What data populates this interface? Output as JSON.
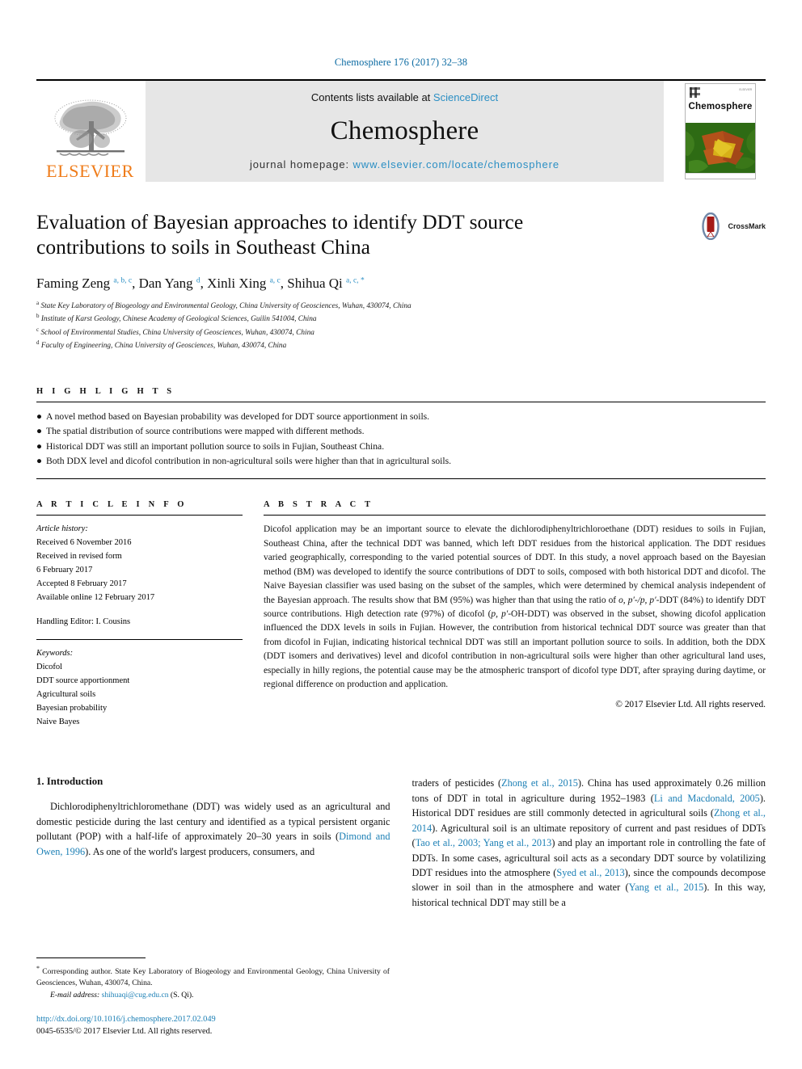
{
  "running_head": "Chemosphere 176 (2017) 32–38",
  "masthead": {
    "publisher_logo_text": "ELSEVIER",
    "contents_prefix": "Contents lists available at ",
    "contents_link": "ScienceDirect",
    "journal_name": "Chemosphere",
    "homepage_prefix": "journal homepage: ",
    "homepage_url": "www.elsevier.com/locate/chemosphere",
    "cover_title": "Chemosphere",
    "cover_tiny_text": "ELSEVIER"
  },
  "article": {
    "title": "Evaluation of Bayesian approaches to identify DDT source contributions to soils in Southeast China",
    "crossmark_label": "CrossMark",
    "authors_html": "Faming Zeng <sup>a, b, c</sup>, Dan Yang <sup>d</sup>, Xinli Xing <sup>a, c</sup>, Shihua Qi <sup>a, c, *</sup>",
    "affiliations": [
      {
        "marker": "a",
        "text": "State Key Laboratory of Biogeology and Environmental Geology, China University of Geosciences, Wuhan, 430074, China"
      },
      {
        "marker": "b",
        "text": "Institute of Karst Geology, Chinese Academy of Geological Sciences, Guilin 541004, China"
      },
      {
        "marker": "c",
        "text": "School of Environmental Studies, China University of Geosciences, Wuhan, 430074, China"
      },
      {
        "marker": "d",
        "text": "Faculty of Engineering, China University of Geosciences, Wuhan, 430074, China"
      }
    ]
  },
  "highlights": {
    "heading": "H I G H L I G H T S",
    "bullet_glyph": "●",
    "items": [
      "A novel method based on Bayesian probability was developed for DDT source apportionment in soils.",
      "The spatial distribution of source contributions were mapped with different methods.",
      "Historical DDT was still an important pollution source to soils in Fujian, Southeast China.",
      "Both DDX level and dicofol contribution in non-agricultural soils were higher than that in agricultural soils."
    ]
  },
  "article_info": {
    "heading": "A R T I C L E   I N F O",
    "history_label": "Article history:",
    "history_lines": [
      "Received 6 November 2016",
      "Received in revised form",
      "6 February 2017",
      "Accepted 8 February 2017",
      "Available online 12 February 2017"
    ],
    "handling_editor": "Handling Editor: I. Cousins",
    "keywords_label": "Keywords:",
    "keywords": [
      "Dicofol",
      "DDT source apportionment",
      "Agricultural soils",
      "Bayesian probability",
      "Naive Bayes"
    ]
  },
  "abstract": {
    "heading": "A B S T R A C T",
    "paragraph_html": "Dicofol application may be an important source to elevate the dichlorodiphenyltrichloroethane (DDT) residues to soils in Fujian, Southeast China, after the technical DDT was banned, which left DDT residues from the historical application. The DDT residues varied geographically, corresponding to the varied potential sources of DDT. In this study, a novel approach based on the Bayesian method (BM) was developed to identify the source contributions of DDT to soils, composed with both historical DDT and dicofol. The Naive Bayesian classifier was used basing on the subset of the samples, which were determined by chemical analysis independent of the Bayesian approach. The results show that BM (95%) was higher than that using the ratio of <i>o, p′-/p, p′</i>-DDT (84%) to identify DDT source contributions. High detection rate (97%) of dicofol (<i>p, p′</i>-OH-DDT) was observed in the subset, showing dicofol application influenced the DDX levels in soils in Fujian. However, the contribution from historical technical DDT source was greater than that from dicofol in Fujian, indicating historical technical DDT was still an important pollution source to soils. In addition, both the DDX (DDT isomers and derivatives) level and dicofol contribution in non-agricultural soils were higher than other agricultural land uses, especially in hilly regions, the potential cause may be the atmospheric transport of dicofol type DDT, after spraying during daytime, or regional difference on production and application.",
    "copyright": "© 2017 Elsevier Ltd. All rights reserved."
  },
  "introduction": {
    "section_number_title": "1. Introduction",
    "left_paragraph_html": "Dichlorodiphenyltrichloromethane (DDT) was widely used as an agricultural and domestic pesticide during the last century and identified as a typical persistent organic pollutant (POP) with a half-life of approximately 20–30 years in soils (<span class=\"cit\">Dimond and Owen, 1996</span>). As one of the world's largest producers, consumers, and",
    "right_paragraph_html": "traders of pesticides (<span class=\"cit\">Zhong et al., 2015</span>). China has used approximately 0.26 million tons of DDT in total in agriculture during 1952–1983 (<span class=\"cit\">Li and Macdonald, 2005</span>). Historical DDT residues are still commonly detected in agricultural soils (<span class=\"cit\">Zhong et al., 2014</span>). Agricultural soil is an ultimate repository of current and past residues of DDTs (<span class=\"cit\">Tao et al., 2003; Yang et al., 2013</span>) and play an important role in controlling the fate of DDTs. In some cases, agricultural soil acts as a secondary DDT source by volatilizing DDT residues into the atmosphere (<span class=\"cit\">Syed et al., 2013</span>), since the compounds decompose slower in soil than in the atmosphere and water (<span class=\"cit\">Yang et al., 2015</span>). In this way, historical technical DDT may still be a"
  },
  "footer": {
    "corresponding_html": "<span class=\"star\">*</span> Corresponding author. State Key Laboratory of Biogeology and Environmental Geology, China University of Geosciences, Wuhan, 430074, China.",
    "email_label": "E-mail address:",
    "email": "shihuaqi@cug.edu.cn",
    "email_suffix": "(S. Qi).",
    "doi": "http://dx.doi.org/10.1016/j.chemosphere.2017.02.049",
    "issn_line": "0045-6535/© 2017 Elsevier Ltd. All rights reserved."
  },
  "colors": {
    "link_blue": "#1b7fb5",
    "header_blue": "#0b6aa2",
    "elsevier_orange": "#ef7c1a",
    "band_gray": "#e6e6e6"
  }
}
